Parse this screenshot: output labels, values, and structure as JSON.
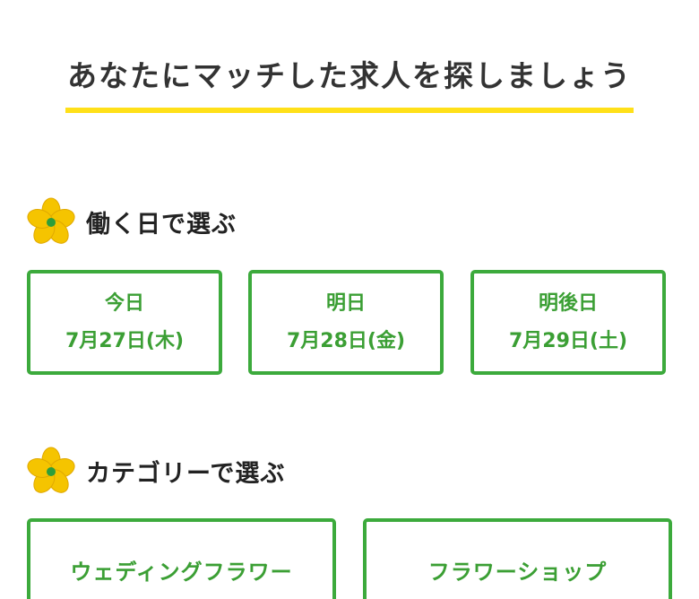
{
  "heading": "あなたにマッチした求人を探しましょう",
  "colors": {
    "accent_green": "#3caa3c",
    "underline_yellow": "#ffe019",
    "flower_yellow": "#f5c400",
    "flower_center": "#2e9e3a"
  },
  "sections": {
    "by_day": {
      "title": "働く日で選ぶ",
      "icon": "flower-icon",
      "buttons": [
        {
          "name": "今日",
          "date": "7月27日(木)"
        },
        {
          "name": "明日",
          "date": "7月28日(金)"
        },
        {
          "name": "明後日",
          "date": "7月29日(土)"
        }
      ]
    },
    "by_category": {
      "title": "カテゴリーで選ぶ",
      "icon": "flower-icon",
      "buttons": [
        {
          "label": "ウェディングフラワー"
        },
        {
          "label": "フラワーショップ"
        }
      ]
    }
  }
}
